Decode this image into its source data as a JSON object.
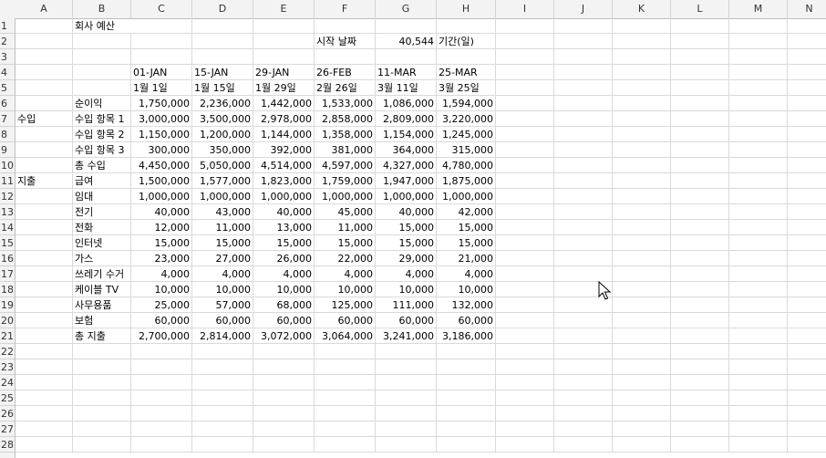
{
  "columns": [
    "A",
    "B",
    "C",
    "D",
    "E",
    "F",
    "G",
    "H",
    "I",
    "J",
    "K",
    "L",
    "M",
    "N"
  ],
  "rows": [
    "1",
    "2",
    "3",
    "4",
    "5",
    "6",
    "7",
    "8",
    "9",
    "10",
    "11",
    "12",
    "13",
    "14",
    "15",
    "16",
    "17",
    "18",
    "19",
    "20",
    "21",
    "22",
    "23",
    "24",
    "25",
    "26",
    "27",
    "28"
  ],
  "title": "회사 예산",
  "start_date_label": "시작 날짜",
  "start_date_value": "40,544",
  "period_label": "기간(일)",
  "dates_row4": [
    "01-JAN",
    "15-JAN",
    "29-JAN",
    "26-FEB",
    "11-MAR",
    "25-MAR"
  ],
  "dates_row5": [
    "1월 1일",
    "1월 15일",
    "1월 29일",
    "2월 26일",
    "3월 11일",
    "3월 25일"
  ],
  "income_section_label": "수입",
  "expense_section_label": "지출",
  "table": [
    {
      "label": "순이익",
      "values": [
        "1,750,000",
        "2,236,000",
        "1,442,000",
        "1,533,000",
        "1,086,000",
        "1,594,000"
      ]
    },
    {
      "label": "수입 항목 1",
      "values": [
        "3,000,000",
        "3,500,000",
        "2,978,000",
        "2,858,000",
        "2,809,000",
        "3,220,000"
      ]
    },
    {
      "label": "수입 항목 2",
      "values": [
        "1,150,000",
        "1,200,000",
        "1,144,000",
        "1,358,000",
        "1,154,000",
        "1,245,000"
      ]
    },
    {
      "label": "수입 항목 3",
      "values": [
        "300,000",
        "350,000",
        "392,000",
        "381,000",
        "364,000",
        "315,000"
      ]
    },
    {
      "label": "총 수입",
      "values": [
        "4,450,000",
        "5,050,000",
        "4,514,000",
        "4,597,000",
        "4,327,000",
        "4,780,000"
      ]
    },
    {
      "label": "급여",
      "values": [
        "1,500,000",
        "1,577,000",
        "1,823,000",
        "1,759,000",
        "1,947,000",
        "1,875,000"
      ]
    },
    {
      "label": "임대",
      "values": [
        "1,000,000",
        "1,000,000",
        "1,000,000",
        "1,000,000",
        "1,000,000",
        "1,000,000"
      ]
    },
    {
      "label": "전기",
      "values": [
        "40,000",
        "43,000",
        "40,000",
        "45,000",
        "40,000",
        "42,000"
      ]
    },
    {
      "label": "전화",
      "values": [
        "12,000",
        "11,000",
        "13,000",
        "11,000",
        "15,000",
        "15,000"
      ]
    },
    {
      "label": "인터넷",
      "values": [
        "15,000",
        "15,000",
        "15,000",
        "15,000",
        "15,000",
        "15,000"
      ]
    },
    {
      "label": "가스",
      "values": [
        "23,000",
        "27,000",
        "26,000",
        "22,000",
        "29,000",
        "21,000"
      ]
    },
    {
      "label": "쓰레기 수거",
      "values": [
        "4,000",
        "4,000",
        "4,000",
        "4,000",
        "4,000",
        "4,000"
      ]
    },
    {
      "label": "케이블 TV",
      "values": [
        "10,000",
        "10,000",
        "10,000",
        "10,000",
        "10,000",
        "10,000"
      ]
    },
    {
      "label": "사무용품",
      "values": [
        "25,000",
        "57,000",
        "68,000",
        "125,000",
        "111,000",
        "132,000"
      ]
    },
    {
      "label": "보험",
      "values": [
        "60,000",
        "60,000",
        "60,000",
        "60,000",
        "60,000",
        "60,000"
      ]
    },
    {
      "label": "총 지출",
      "values": [
        "2,700,000",
        "2,814,000",
        "3,072,000",
        "3,064,000",
        "3,241,000",
        "3,186,000"
      ]
    }
  ],
  "cursor_icon": "mouse-pointer-icon"
}
